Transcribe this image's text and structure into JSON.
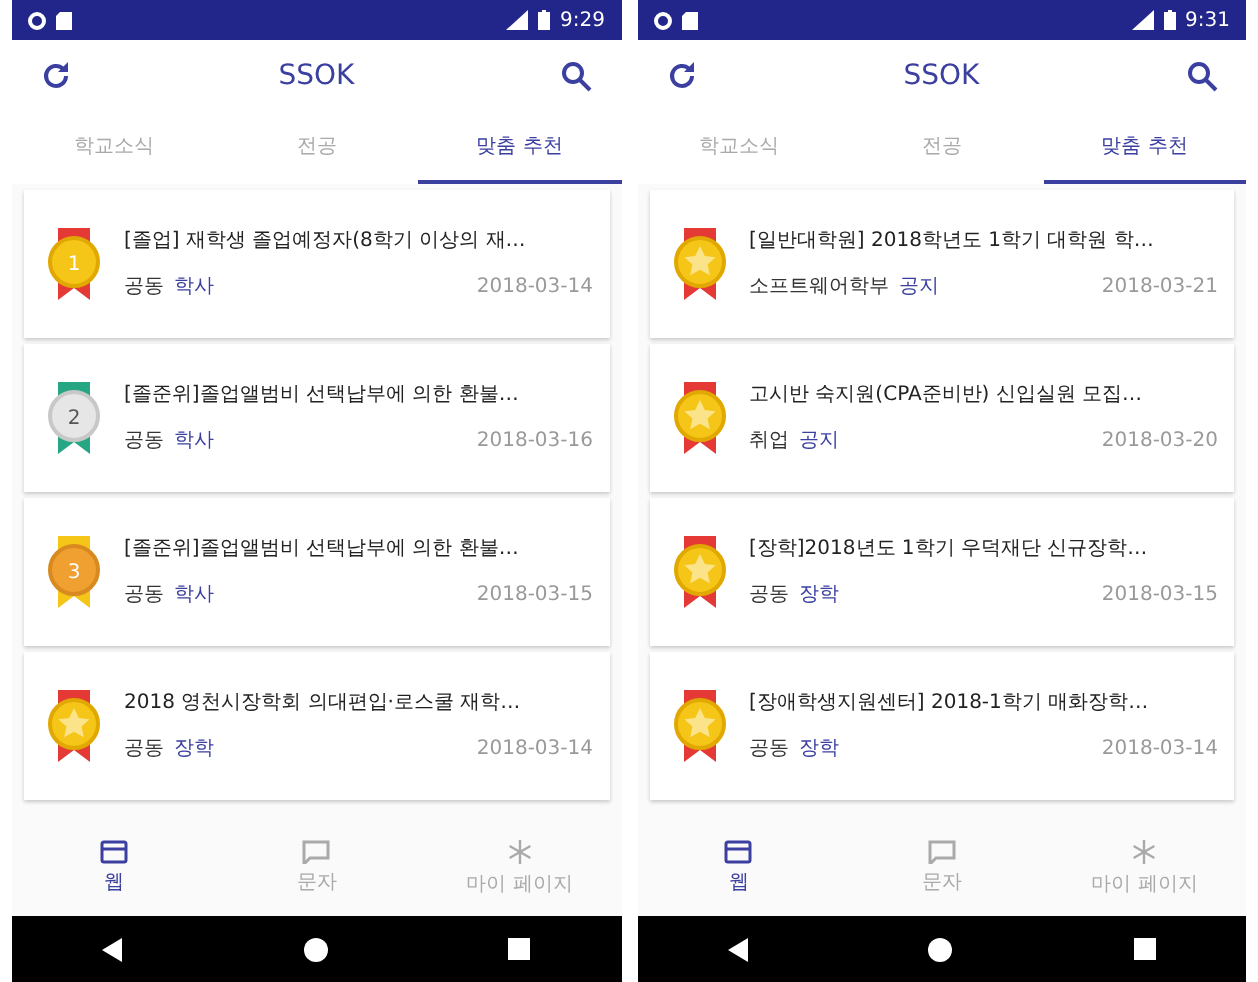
{
  "phones": [
    {
      "status_bar": {
        "time": "9:29"
      },
      "app_bar": {
        "title": "SSOK"
      },
      "tabs": [
        {
          "label": "학교소식",
          "selected": false
        },
        {
          "label": "전공",
          "selected": false
        },
        {
          "label": "맞춤 추천",
          "selected": true
        }
      ],
      "items": [
        {
          "kind": "gold",
          "medal_label": "1",
          "title": "[졸업] 재학생 졸업예정자(8학기 이상의 재…",
          "department": "공동",
          "category": "학사",
          "date": "2018-03-14"
        },
        {
          "kind": "silver",
          "medal_label": "2",
          "title": "[졸준위]졸업앨범비 선택납부에 의한 환불…",
          "department": "공동",
          "category": "학사",
          "date": "2018-03-16"
        },
        {
          "kind": "bronze",
          "medal_label": "3",
          "title": "[졸준위]졸업앨범비 선택납부에 의한 환불…",
          "department": "공동",
          "category": "학사",
          "date": "2018-03-15"
        },
        {
          "kind": "star",
          "title": "2018 영천시장학회 의대편입·로스쿨 재학…",
          "department": "공동",
          "category": "장학",
          "date": "2018-03-14"
        }
      ],
      "bottom_nav": [
        {
          "label": "웹",
          "kind": "web",
          "selected": true
        },
        {
          "label": "문자",
          "kind": "message",
          "selected": false
        },
        {
          "label": "마이 페이지",
          "kind": "snow",
          "selected": false
        }
      ]
    },
    {
      "status_bar": {
        "time": "9:31"
      },
      "app_bar": {
        "title": "SSOK"
      },
      "tabs": [
        {
          "label": "학교소식",
          "selected": false
        },
        {
          "label": "전공",
          "selected": false
        },
        {
          "label": "맞춤 추천",
          "selected": true
        }
      ],
      "items": [
        {
          "kind": "star",
          "title": "[일반대학원] 2018학년도 1학기 대학원 학…",
          "department": "소프트웨어학부",
          "category": "공지",
          "date": "2018-03-21"
        },
        {
          "kind": "star",
          "title": "고시반 숙지원(CPA준비반) 신입실원 모집…",
          "department": "취업",
          "category": "공지",
          "date": "2018-03-20"
        },
        {
          "kind": "star",
          "title": "[장학]2018년도 1학기 우덕재단 신규장학…",
          "department": "공동",
          "category": "장학",
          "date": "2018-03-15"
        },
        {
          "kind": "star",
          "title": "[장애학생지원센터] 2018-1학기 매화장학…",
          "department": "공동",
          "category": "장학",
          "date": "2018-03-14"
        }
      ],
      "bottom_nav": [
        {
          "label": "웹",
          "kind": "web",
          "selected": true
        },
        {
          "label": "문자",
          "kind": "message",
          "selected": false
        },
        {
          "label": "마이 페이지",
          "kind": "snow",
          "selected": false
        }
      ]
    }
  ]
}
